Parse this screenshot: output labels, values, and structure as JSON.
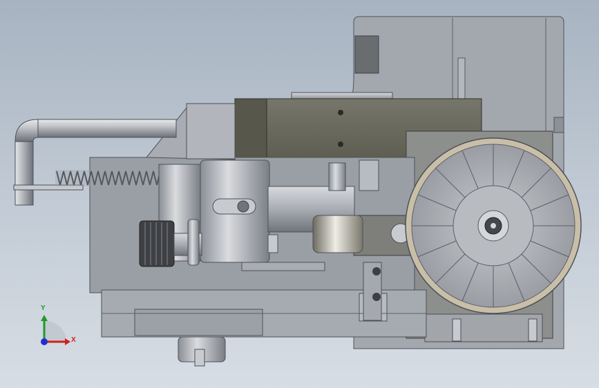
{
  "viewport": {
    "background_top": "#a7b3c1",
    "background_bottom": "#d7dde4"
  },
  "model": {
    "parts": [
      "back-housing",
      "gearbox-block",
      "handwheel",
      "tube-handle",
      "return-spring",
      "slider-carriage",
      "knurled-knob",
      "guide-roller",
      "base-rail",
      "bottom-boss"
    ],
    "colors": {
      "steel": "#b9bcc2",
      "steel_dark": "#7f838a",
      "gearbox": "#6b6b5e",
      "gearbox_light": "#8c8c7f",
      "housing": "#9ea3aa",
      "wheel_rim": "#c9bfa8",
      "wheel_face": "#a5a7ad"
    }
  },
  "triad": {
    "x_label": "X",
    "y_label": "Y",
    "x_color": "#d21f1f",
    "y_color": "#1f9a2a",
    "z_color": "#1f2fd2"
  }
}
